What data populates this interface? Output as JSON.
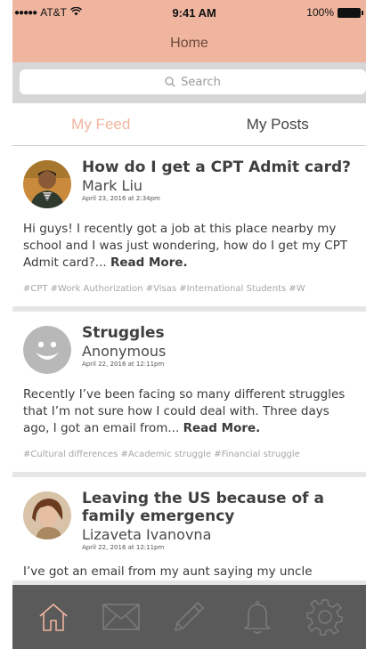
{
  "status_bar": {
    "carrier": "AT&T",
    "time": "9:41 AM",
    "battery": "100%"
  },
  "nav": {
    "title": "Home"
  },
  "search": {
    "placeholder": "Search"
  },
  "segments": [
    {
      "label": "My Feed",
      "active": true
    },
    {
      "label": "My Posts",
      "active": false
    }
  ],
  "posts": [
    {
      "title": "How do I get a CPT Admit card?",
      "author": "Mark Liu",
      "date": "April 23, 2016 at 2:34pm",
      "body": "Hi guys! I recently got a job at this place nearby my school and I was just wondering, how do I get my CPT Admit card?...",
      "read_more": "Read More.",
      "tags": "#CPT #Work Authorization #Visas #International Students #W",
      "avatar_icon": "user-photo-icon"
    },
    {
      "title": "Struggles",
      "author": "Anonymous",
      "date": "April 22, 2016 at 12:11pm",
      "body": "Recently I’ve been facing so many different struggles that I’m not sure how I could deal with. Three days ago, I got an email from...",
      "read_more": "Read More.",
      "tags": "#Cultural differences #Academic struggle #Financial struggle",
      "avatar_icon": "anonymous-smiley-icon"
    },
    {
      "title": "Leaving the US because of a family emergency",
      "author": "Lizaveta Ivanovna",
      "date": "April 22, 2016 at 12:11pm",
      "body": "I’ve got an email from my aunt saying my uncle",
      "read_more": "",
      "tags": "",
      "avatar_icon": "user-photo-icon"
    }
  ],
  "tab_bar": {
    "items": [
      "home-icon",
      "mail-icon",
      "pencil-icon",
      "bell-icon",
      "gear-icon"
    ],
    "active_color": "#f0b59f",
    "inactive_color": "#7a7a7a"
  },
  "colors": {
    "accent": "#f0b59f",
    "tab_bar_bg": "#5a5a5a",
    "tag_text": "#a6a6a6"
  }
}
